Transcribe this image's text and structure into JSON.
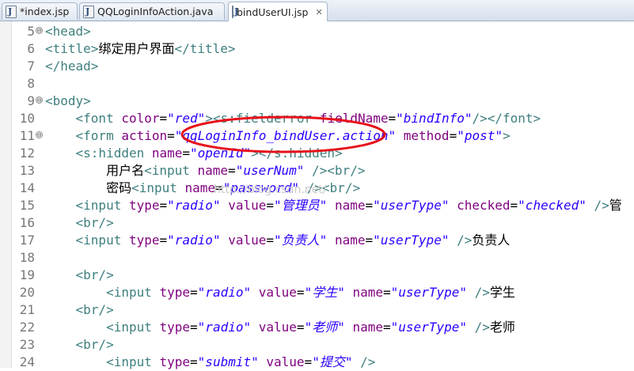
{
  "tabs": [
    {
      "label": "*index.jsp",
      "active": false,
      "icon": "jsp-file-icon"
    },
    {
      "label": "QQLoginInfoAction.java",
      "active": false,
      "icon": "java-file-icon"
    },
    {
      "label": "bindUserUI.jsp",
      "active": true,
      "icon": "jsp-file-icon",
      "close": "✕"
    }
  ],
  "editor": {
    "lines": [
      {
        "num": "5",
        "fold": "⊖",
        "tokens": [
          {
            "t": "<head>",
            "c": "tg"
          }
        ]
      },
      {
        "num": "6",
        "tokens": [
          {
            "t": "<title>",
            "c": "tg"
          },
          {
            "t": "绑定用户界面",
            "c": "tx"
          },
          {
            "t": "</title>",
            "c": "tg"
          }
        ]
      },
      {
        "num": "7",
        "tokens": [
          {
            "t": "</head>",
            "c": "tg"
          }
        ]
      },
      {
        "num": "8",
        "tokens": []
      },
      {
        "num": "9",
        "fold": "⊖",
        "tokens": [
          {
            "t": "<body>",
            "c": "tg"
          }
        ]
      },
      {
        "num": "10",
        "tokens": [
          {
            "t": "    ",
            "c": "tx"
          },
          {
            "t": "<font ",
            "c": "tg"
          },
          {
            "t": "color",
            "c": "at"
          },
          {
            "t": "=",
            "c": "tx"
          },
          {
            "t": "\"red\"",
            "c": "vl"
          },
          {
            "t": "><s:fielderror ",
            "c": "tg"
          },
          {
            "t": "fieldName",
            "c": "at"
          },
          {
            "t": "=",
            "c": "tx"
          },
          {
            "t": "\"bindInfo\"",
            "c": "vl"
          },
          {
            "t": "/></font>",
            "c": "tg"
          }
        ]
      },
      {
        "num": "11",
        "fold": "⊖",
        "tokens": [
          {
            "t": "    ",
            "c": "tx"
          },
          {
            "t": "<form ",
            "c": "tg"
          },
          {
            "t": "action",
            "c": "at"
          },
          {
            "t": "=",
            "c": "tx"
          },
          {
            "t": "\"qqLoginInfo_bindUser.action\"",
            "c": "vl"
          },
          {
            "t": " ",
            "c": "tx"
          },
          {
            "t": "method",
            "c": "at"
          },
          {
            "t": "=",
            "c": "tx"
          },
          {
            "t": "\"post\"",
            "c": "vl"
          },
          {
            "t": ">",
            "c": "tg"
          }
        ]
      },
      {
        "num": "12",
        "tokens": [
          {
            "t": "    ",
            "c": "tx"
          },
          {
            "t": "<s:hidden ",
            "c": "tg"
          },
          {
            "t": "name",
            "c": "at"
          },
          {
            "t": "=",
            "c": "tx"
          },
          {
            "t": "\"openId\"",
            "c": "vl"
          },
          {
            "t": "></s:hidden>",
            "c": "tg"
          }
        ]
      },
      {
        "num": "13",
        "tokens": [
          {
            "t": "        ",
            "c": "tx"
          },
          {
            "t": "用户名",
            "c": "tx"
          },
          {
            "t": "<input ",
            "c": "tg"
          },
          {
            "t": "name",
            "c": "at"
          },
          {
            "t": "=",
            "c": "tx"
          },
          {
            "t": "\"userNum\"",
            "c": "vl"
          },
          {
            "t": " /><br/>",
            "c": "tg"
          }
        ]
      },
      {
        "num": "14",
        "tokens": [
          {
            "t": "        ",
            "c": "tx"
          },
          {
            "t": "密码",
            "c": "tx"
          },
          {
            "t": "<input ",
            "c": "tg"
          },
          {
            "t": "name",
            "c": "at"
          },
          {
            "t": "=",
            "c": "tx"
          },
          {
            "t": "\"password\"",
            "c": "vl"
          },
          {
            "t": " /><br/>",
            "c": "tg"
          }
        ]
      },
      {
        "num": "15",
        "tokens": [
          {
            "t": "    ",
            "c": "tx"
          },
          {
            "t": "<input ",
            "c": "tg"
          },
          {
            "t": "type",
            "c": "at"
          },
          {
            "t": "=",
            "c": "tx"
          },
          {
            "t": "\"radio\"",
            "c": "vl"
          },
          {
            "t": " ",
            "c": "tx"
          },
          {
            "t": "value",
            "c": "at"
          },
          {
            "t": "=",
            "c": "tx"
          },
          {
            "t": "\"管理员\"",
            "c": "vl"
          },
          {
            "t": " ",
            "c": "tx"
          },
          {
            "t": "name",
            "c": "at"
          },
          {
            "t": "=",
            "c": "tx"
          },
          {
            "t": "\"userType\"",
            "c": "vl"
          },
          {
            "t": " ",
            "c": "tx"
          },
          {
            "t": "checked",
            "c": "at"
          },
          {
            "t": "=",
            "c": "tx"
          },
          {
            "t": "\"checked\"",
            "c": "vl"
          },
          {
            "t": " />",
            "c": "tg"
          },
          {
            "t": "管",
            "c": "tx"
          }
        ]
      },
      {
        "num": "16",
        "tokens": [
          {
            "t": "    ",
            "c": "tx"
          },
          {
            "t": "<br/>",
            "c": "tg"
          }
        ]
      },
      {
        "num": "17",
        "tokens": [
          {
            "t": "    ",
            "c": "tx"
          },
          {
            "t": "<input ",
            "c": "tg"
          },
          {
            "t": "type",
            "c": "at"
          },
          {
            "t": "=",
            "c": "tx"
          },
          {
            "t": "\"radio\"",
            "c": "vl"
          },
          {
            "t": " ",
            "c": "tx"
          },
          {
            "t": "value",
            "c": "at"
          },
          {
            "t": "=",
            "c": "tx"
          },
          {
            "t": "\"负责人\"",
            "c": "vl"
          },
          {
            "t": " ",
            "c": "tx"
          },
          {
            "t": "name",
            "c": "at"
          },
          {
            "t": "=",
            "c": "tx"
          },
          {
            "t": "\"userType\"",
            "c": "vl"
          },
          {
            "t": " />",
            "c": "tg"
          },
          {
            "t": "负责人",
            "c": "tx"
          }
        ]
      },
      {
        "num": "18",
        "tokens": []
      },
      {
        "num": "19",
        "tokens": [
          {
            "t": "    ",
            "c": "tx"
          },
          {
            "t": "<br/>",
            "c": "tg"
          }
        ]
      },
      {
        "num": "20",
        "tokens": [
          {
            "t": "        ",
            "c": "tx"
          },
          {
            "t": "<input ",
            "c": "tg"
          },
          {
            "t": "type",
            "c": "at"
          },
          {
            "t": "=",
            "c": "tx"
          },
          {
            "t": "\"radio\"",
            "c": "vl"
          },
          {
            "t": " ",
            "c": "tx"
          },
          {
            "t": "value",
            "c": "at"
          },
          {
            "t": "=",
            "c": "tx"
          },
          {
            "t": "\"学生\"",
            "c": "vl"
          },
          {
            "t": " ",
            "c": "tx"
          },
          {
            "t": "name",
            "c": "at"
          },
          {
            "t": "=",
            "c": "tx"
          },
          {
            "t": "\"userType\"",
            "c": "vl"
          },
          {
            "t": " />",
            "c": "tg"
          },
          {
            "t": "学生",
            "c": "tx"
          }
        ]
      },
      {
        "num": "21",
        "tokens": [
          {
            "t": "    ",
            "c": "tx"
          },
          {
            "t": "<br/>",
            "c": "tg"
          }
        ]
      },
      {
        "num": "22",
        "tokens": [
          {
            "t": "        ",
            "c": "tx"
          },
          {
            "t": "<input ",
            "c": "tg"
          },
          {
            "t": "type",
            "c": "at"
          },
          {
            "t": "=",
            "c": "tx"
          },
          {
            "t": "\"radio\"",
            "c": "vl"
          },
          {
            "t": " ",
            "c": "tx"
          },
          {
            "t": "value",
            "c": "at"
          },
          {
            "t": "=",
            "c": "tx"
          },
          {
            "t": "\"老师\"",
            "c": "vl"
          },
          {
            "t": " ",
            "c": "tx"
          },
          {
            "t": "name",
            "c": "at"
          },
          {
            "t": "=",
            "c": "tx"
          },
          {
            "t": "\"userType\"",
            "c": "vl"
          },
          {
            "t": " />",
            "c": "tg"
          },
          {
            "t": "老师",
            "c": "tx"
          }
        ]
      },
      {
        "num": "23",
        "tokens": [
          {
            "t": "    ",
            "c": "tx"
          },
          {
            "t": "<br/>",
            "c": "tg"
          }
        ]
      },
      {
        "num": "24",
        "tokens": [
          {
            "t": "        ",
            "c": "tx"
          },
          {
            "t": "<input ",
            "c": "tg"
          },
          {
            "t": "type",
            "c": "at"
          },
          {
            "t": "=",
            "c": "tx"
          },
          {
            "t": "\"submit\"",
            "c": "vl"
          },
          {
            "t": " ",
            "c": "tx"
          },
          {
            "t": "value",
            "c": "at"
          },
          {
            "t": "=",
            "c": "tx"
          },
          {
            "t": "\"提交\"",
            "c": "vl"
          },
          {
            "t": " />",
            "c": "tg"
          }
        ]
      }
    ]
  },
  "watermark": "http://blog.csdn.net/",
  "colors": {
    "tag": "#3f7f7f",
    "attribute": "#7f007f",
    "value": "#2a00ff",
    "annotation": "#e8101a"
  }
}
